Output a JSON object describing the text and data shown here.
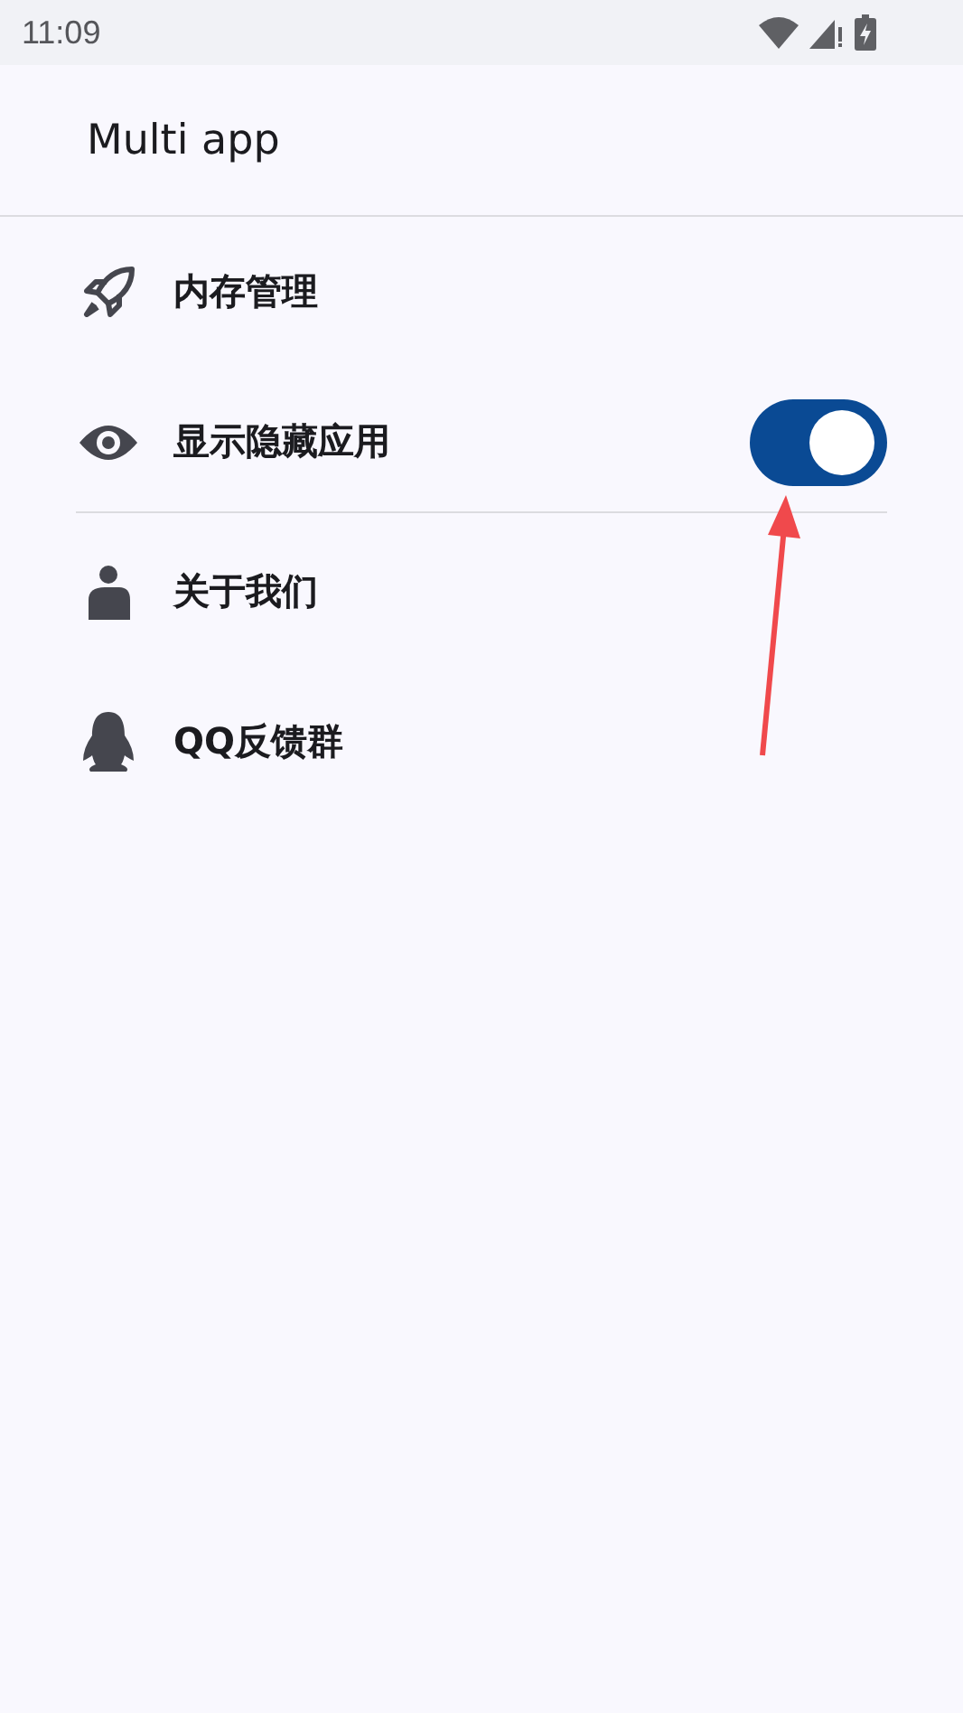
{
  "status_bar": {
    "time": "11:09"
  },
  "app_bar": {
    "title": "Multi app"
  },
  "menu": [
    {
      "kind": "link",
      "label": "内存管理",
      "divider": false
    },
    {
      "kind": "toggle",
      "label": "显示隐藏应用",
      "on": true,
      "divider": true
    },
    {
      "kind": "link",
      "label": "关于我们",
      "divider": false
    },
    {
      "kind": "link",
      "label": "QQ反馈群",
      "divider": false
    }
  ],
  "annotation": {
    "kind": "arrow"
  }
}
